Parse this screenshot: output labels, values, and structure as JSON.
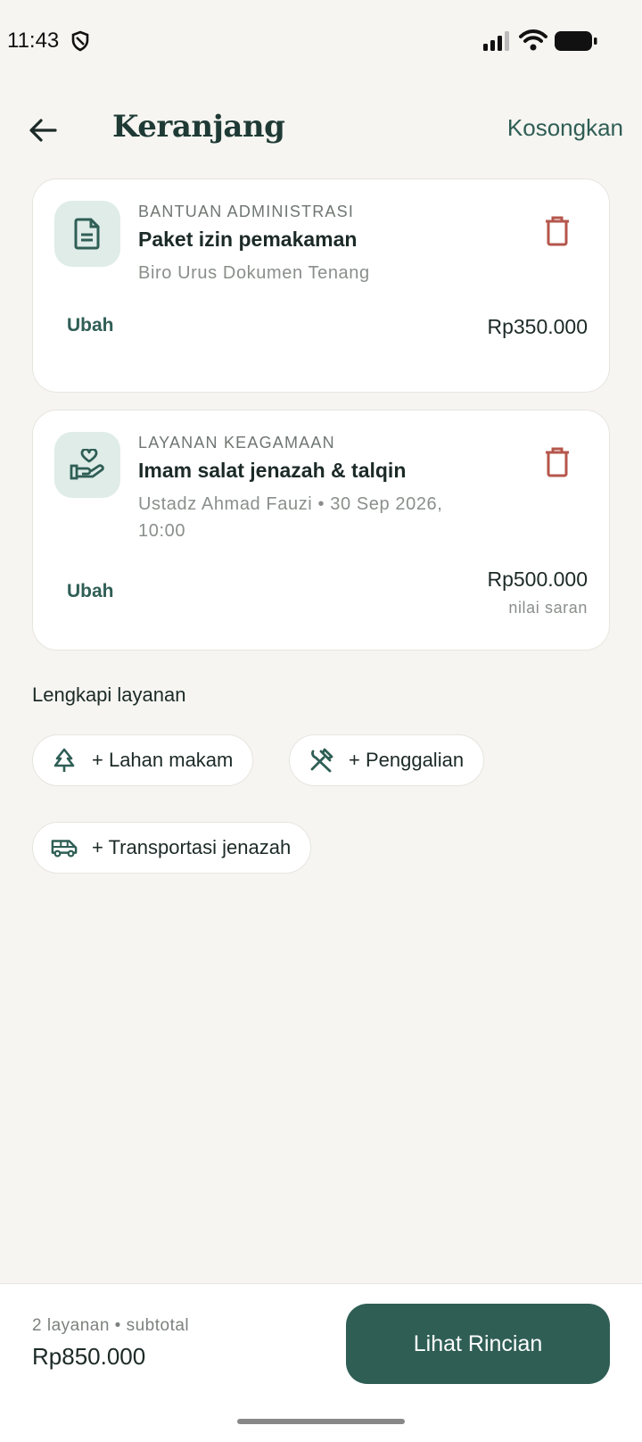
{
  "status_bar": {
    "time": "11:43"
  },
  "header": {
    "title": "Keranjang",
    "clear_label": "Kosongkan"
  },
  "cart": {
    "items": [
      {
        "category": "BANTUAN ADMINISTRASI",
        "title": "Paket izin pemakaman",
        "subtitle": "Biro Urus Dokumen Tenang",
        "edit_label": "Ubah",
        "price": "Rp350.000",
        "icon": "document-icon"
      },
      {
        "category": "LAYANAN KEAGAMAAN",
        "title": "Imam salat jenazah & talqin",
        "subtitle": "Ustadz Ahmad Fauzi • 30 Sep 2026, 10:00",
        "edit_label": "Ubah",
        "price": "Rp500.000",
        "price_note": "nilai saran",
        "icon": "hand-heart-icon"
      }
    ]
  },
  "complete_section": {
    "title": "Lengkapi layanan",
    "chips": [
      {
        "label": "+ Lahan makam",
        "icon": "tree-icon"
      },
      {
        "label": "+ Penggalian",
        "icon": "tools-icon"
      },
      {
        "label": "+ Transportasi jenazah",
        "icon": "van-icon"
      }
    ]
  },
  "summary": {
    "meta": "2 layanan • subtotal",
    "total": "Rp850.000",
    "cta_label": "Lihat Rincian"
  },
  "colors": {
    "background": "#f6f5f1",
    "primary": "#2f5e55",
    "icon_bg": "#dfece8",
    "delete": "#b5564b"
  }
}
